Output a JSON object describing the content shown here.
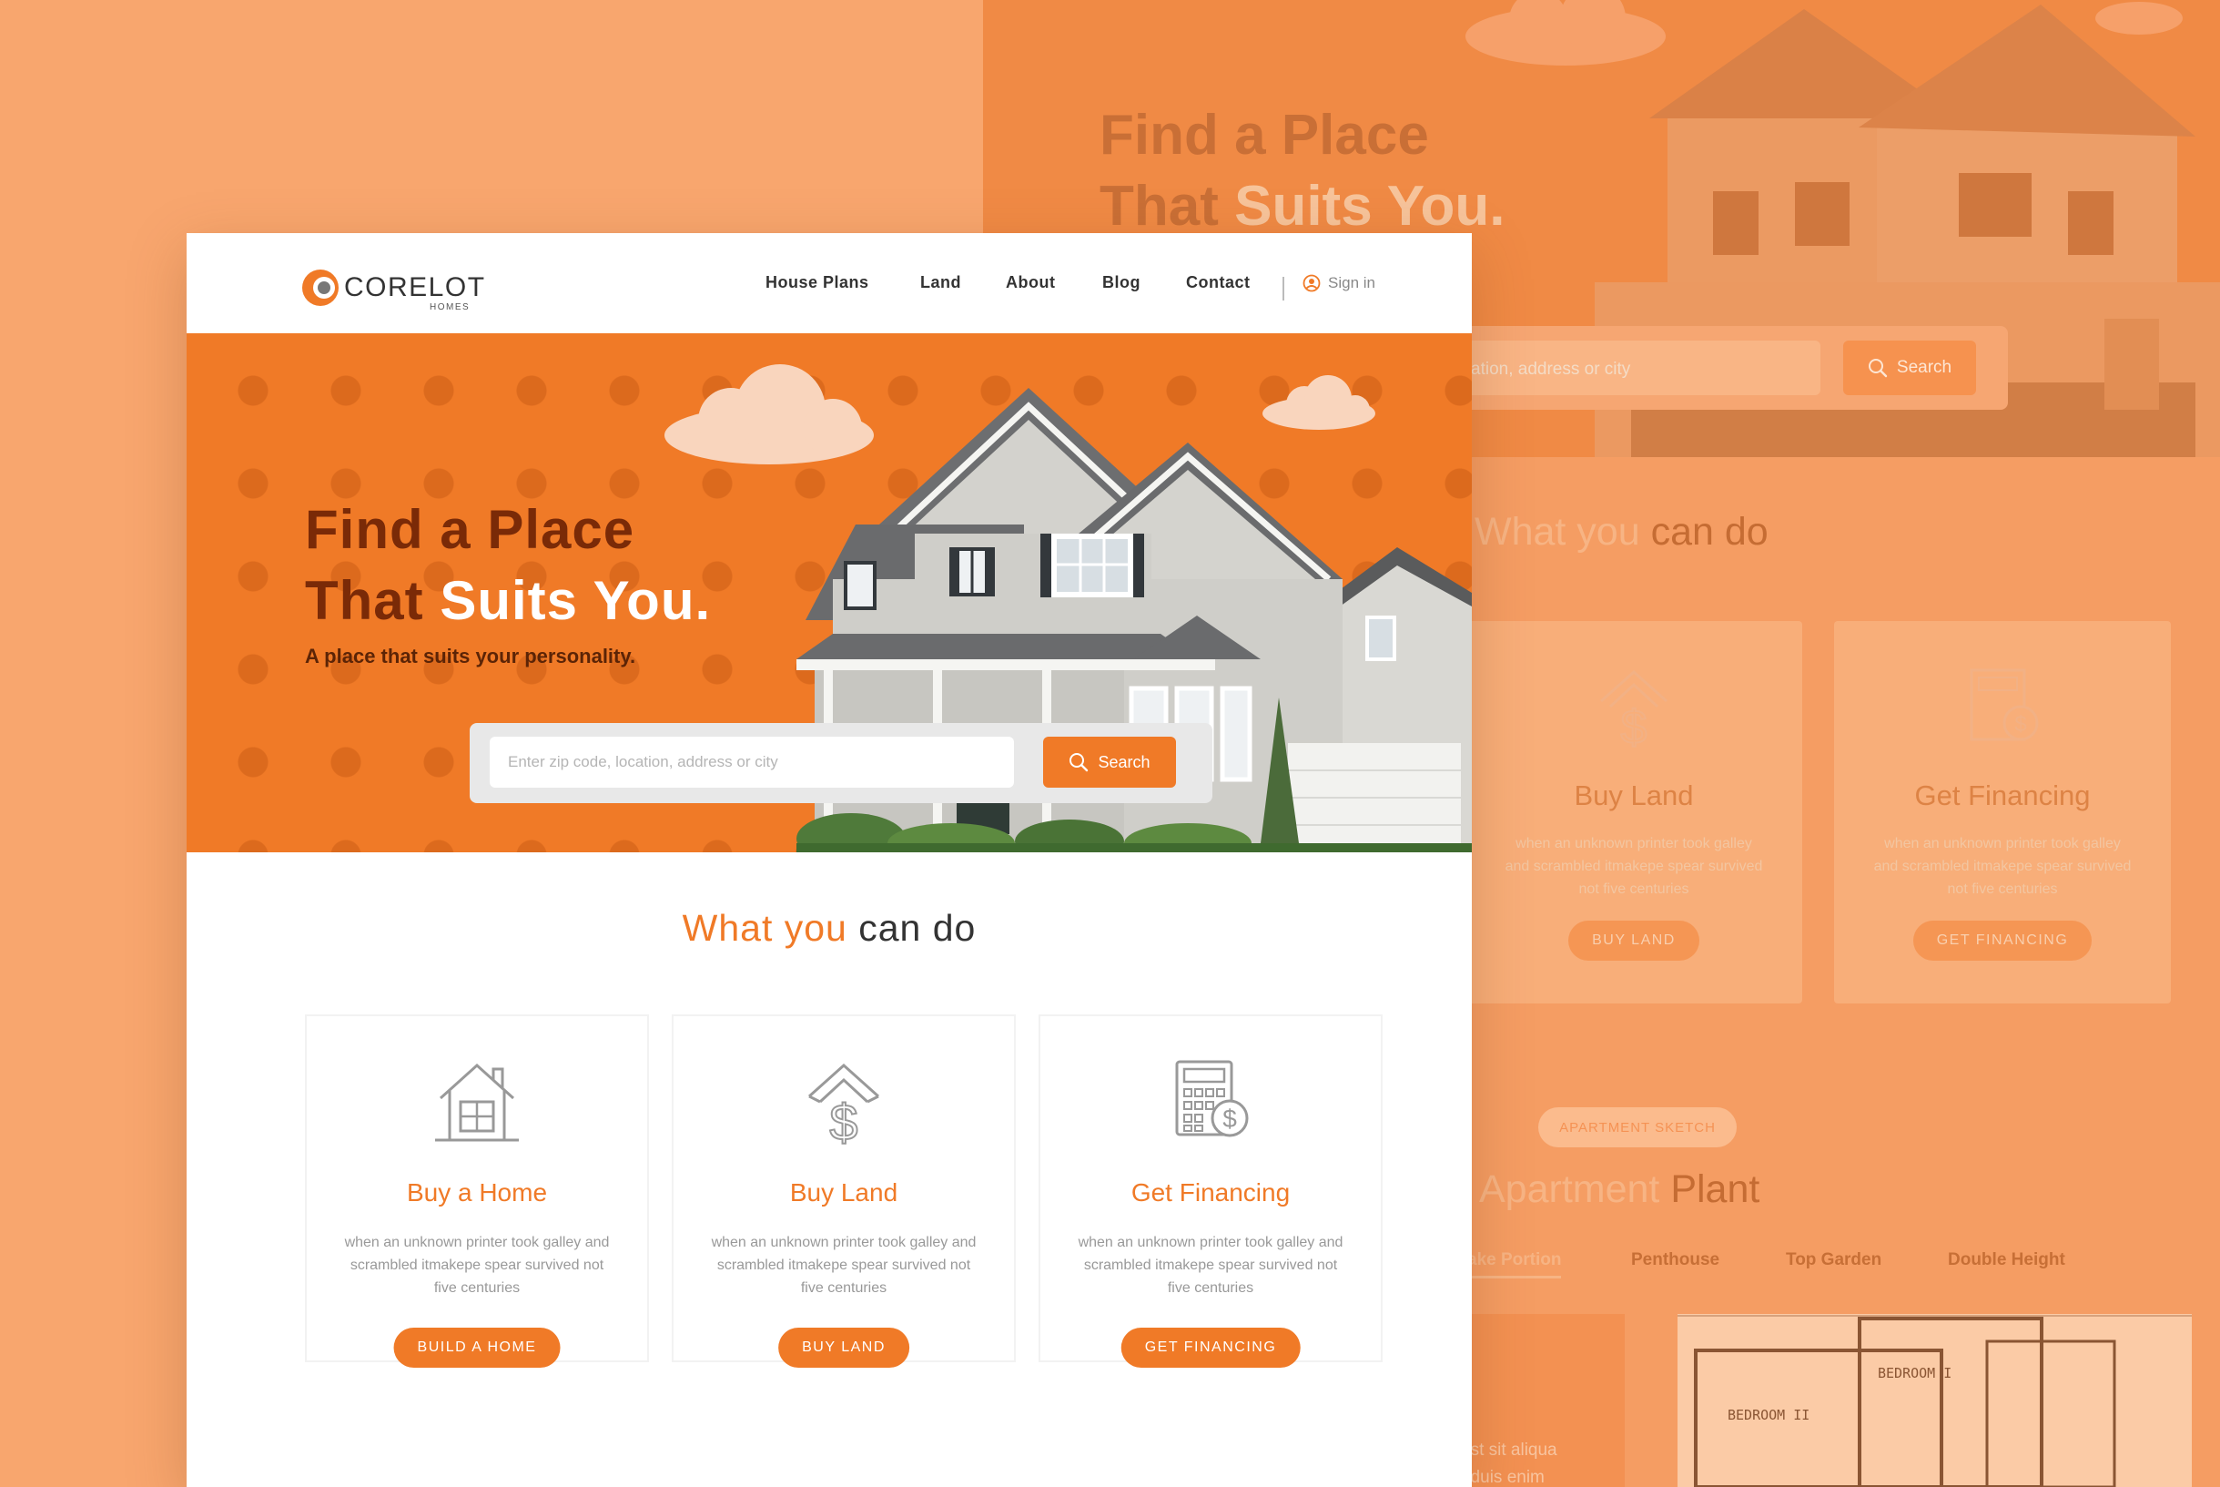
{
  "colors": {
    "brand_orange": "#f07a27",
    "hero_title_dark": "#7a2a07",
    "background_peach": "#f8a66e"
  },
  "brand": {
    "name": "CORELOT",
    "sub": "HOMES"
  },
  "nav": {
    "items": [
      {
        "label": "House Plans"
      },
      {
        "label": "Land"
      },
      {
        "label": "About"
      },
      {
        "label": "Blog"
      },
      {
        "label": "Contact"
      }
    ],
    "signin_label": "Sign in",
    "signin_icon": "user-icon"
  },
  "hero": {
    "title_line1": "Find a Place",
    "title_line2_dark": "That ",
    "title_line2_light": "Suits You.",
    "subtitle": "A place that suits your personality.",
    "search": {
      "placeholder": "Enter zip code, location, address or city",
      "button_label": "Search",
      "button_icon": "search-icon"
    }
  },
  "services": {
    "title_accent": "What you",
    "title_rest": " can do",
    "cards": [
      {
        "icon": "house-icon",
        "title": "Buy a Home",
        "description": "when an unknown printer took galley and scrambled itmakepe spear survived not five centuries",
        "button_label": "BUILD A HOME"
      },
      {
        "icon": "land-dollar-icon",
        "title": "Buy Land",
        "description": "when an unknown printer took galley and scrambled itmakepe spear survived not five centuries",
        "button_label": "BUY LAND"
      },
      {
        "icon": "calculator-icon",
        "title": "Get Financing",
        "description": "when an unknown printer took galley and scrambled itmakepe spear survived not five centuries",
        "button_label": "GET FINANCING"
      }
    ]
  },
  "background_mockup": {
    "hero_title_line1": "Find a Place",
    "hero_title_line2_dark": "That ",
    "hero_title_line2_light": "Suits You.",
    "search_placeholder_fragment": "ation, address or city",
    "search_button": "Search",
    "section_title_accent": "What you",
    "section_title_rest": " can do",
    "cards": [
      {
        "title": "Buy Land",
        "description": "when an unknown printer took galley and scrambled itmakepe spear survived not five centuries",
        "button_label": "BUY LAND"
      },
      {
        "title": "Get Financing",
        "description": "when an unknown printer took galley and scrambled itmakepe spear survived not five centuries",
        "button_label": "GET FINANCING"
      }
    ],
    "pill_label": "APARTMENT SKETCH",
    "apartment_title_accent": "Apartment",
    "apartment_title_rest": " Plant",
    "tabs": [
      "ake Portion",
      "Penthouse",
      "Top Garden",
      "Double Height"
    ],
    "text_fragment_1": "est sit aliqua",
    "text_fragment_2": "t duis enim",
    "plan_label_1": "BEDROOM II",
    "plan_label_2": "BEDROOM I"
  }
}
